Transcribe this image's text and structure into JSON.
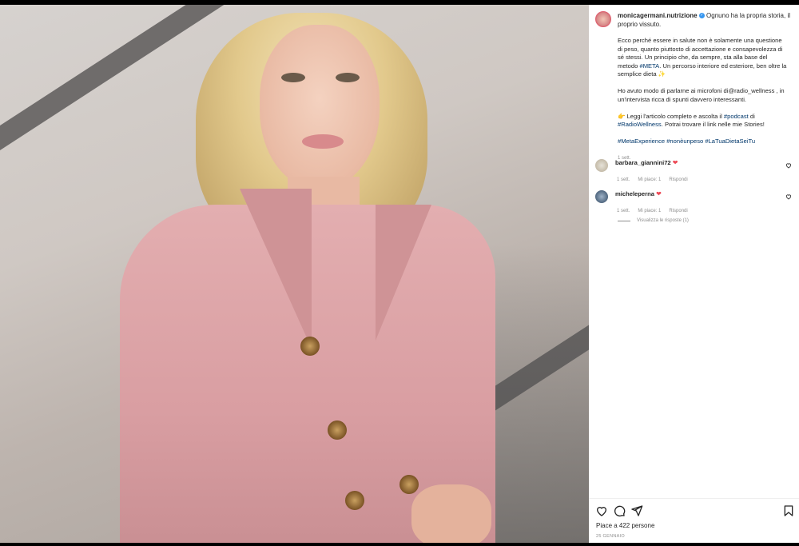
{
  "post": {
    "username": "monicagermani.nutrizione",
    "verified_badge": "✓",
    "caption_intro": "Ognuno ha la propria storia, il proprio vissuto.",
    "paragraph1": "Ecco perché essere in salute non è solamente una questione di peso, quanto piuttosto di accettazione e consapevolezza di sé stessi. Un principio che, da sempre, sta alla base del metodo",
    "paragraph1_tag": "#META",
    "paragraph1_end": ". Un percorso interiore ed esteriore, ben oltre la semplice dieta ✨",
    "paragraph2": "Ho avuto modo di parlarne ai microfoni di@radio_wellness , in un'intervista ricca di spunti davvero interessanti.",
    "paragraph3_start": "👉  Leggi l'articolo completo e ascolta il",
    "paragraph3_tag1": "#podcast",
    "paragraph3_mid": "di",
    "paragraph3_tag2": "#RadioWellness",
    "paragraph3_end": ". Potrai trovare il link nelle mie Stories!",
    "hashtags": "#MetaExperience #nonèunpeso #LaTuaDietaSeiTu",
    "time_ago": "1 sett."
  },
  "comments": [
    {
      "user": "barbara_giannini72",
      "text": "❤",
      "time": "1 sett.",
      "likes": "Mi piace: 1",
      "reply": "Rispondi"
    },
    {
      "user": "micheleperna",
      "text": "❤",
      "time": "1 sett.",
      "likes": "Mi piace: 1",
      "reply": "Rispondi"
    }
  ],
  "view_replies": "Visualizza le risposte (1)",
  "likes_text": "Piace a 422 persone",
  "date_text": "25 GENNAIO",
  "icons": {
    "like": "heart-icon",
    "comment": "comment-icon",
    "share": "share-icon",
    "save": "bookmark-icon",
    "comment_like": "heart-outline-icon"
  },
  "colors": {
    "hashtag": "#00376b",
    "verified": "#3897f0",
    "heart": "#ed4956",
    "muted": "#8e8e8e"
  }
}
